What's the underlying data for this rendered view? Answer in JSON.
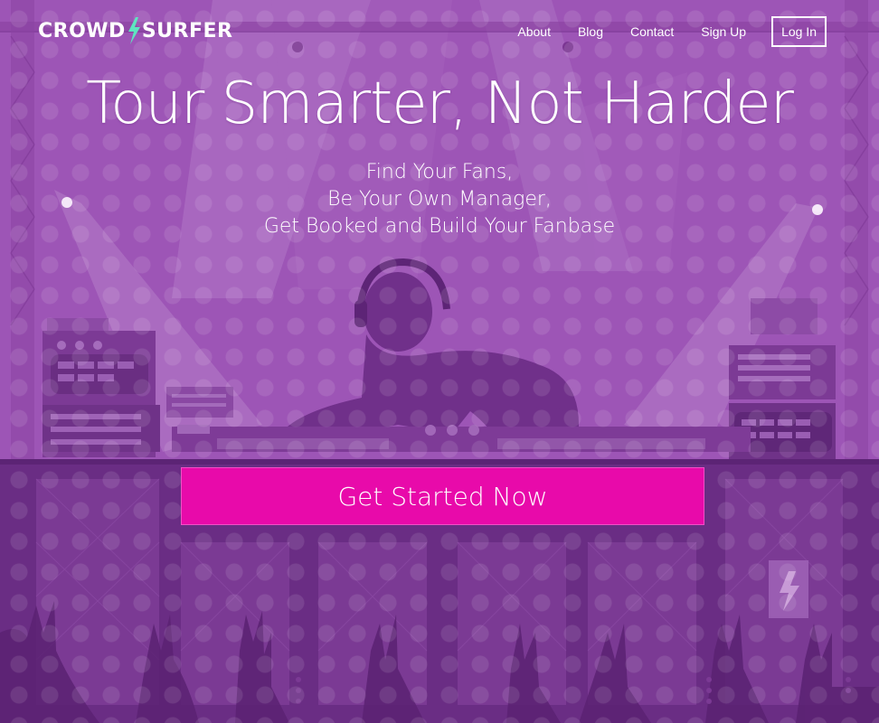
{
  "brand": {
    "logo_left": "CROWD",
    "logo_right": "SURFER",
    "accent_color": "#5ee6c0"
  },
  "nav": {
    "about": "About",
    "blog": "Blog",
    "contact": "Contact",
    "signup": "Sign Up",
    "login": "Log In"
  },
  "hero": {
    "headline": "Tour Smarter, Not Harder",
    "sub_lines": [
      "Find Your Fans,",
      "Be Your Own Manager,",
      "Get Booked and Build Your Fanbase"
    ],
    "cta_label": "Get Started Now",
    "cta_color": "#e80aaa",
    "background_color": "#9d55b6"
  }
}
